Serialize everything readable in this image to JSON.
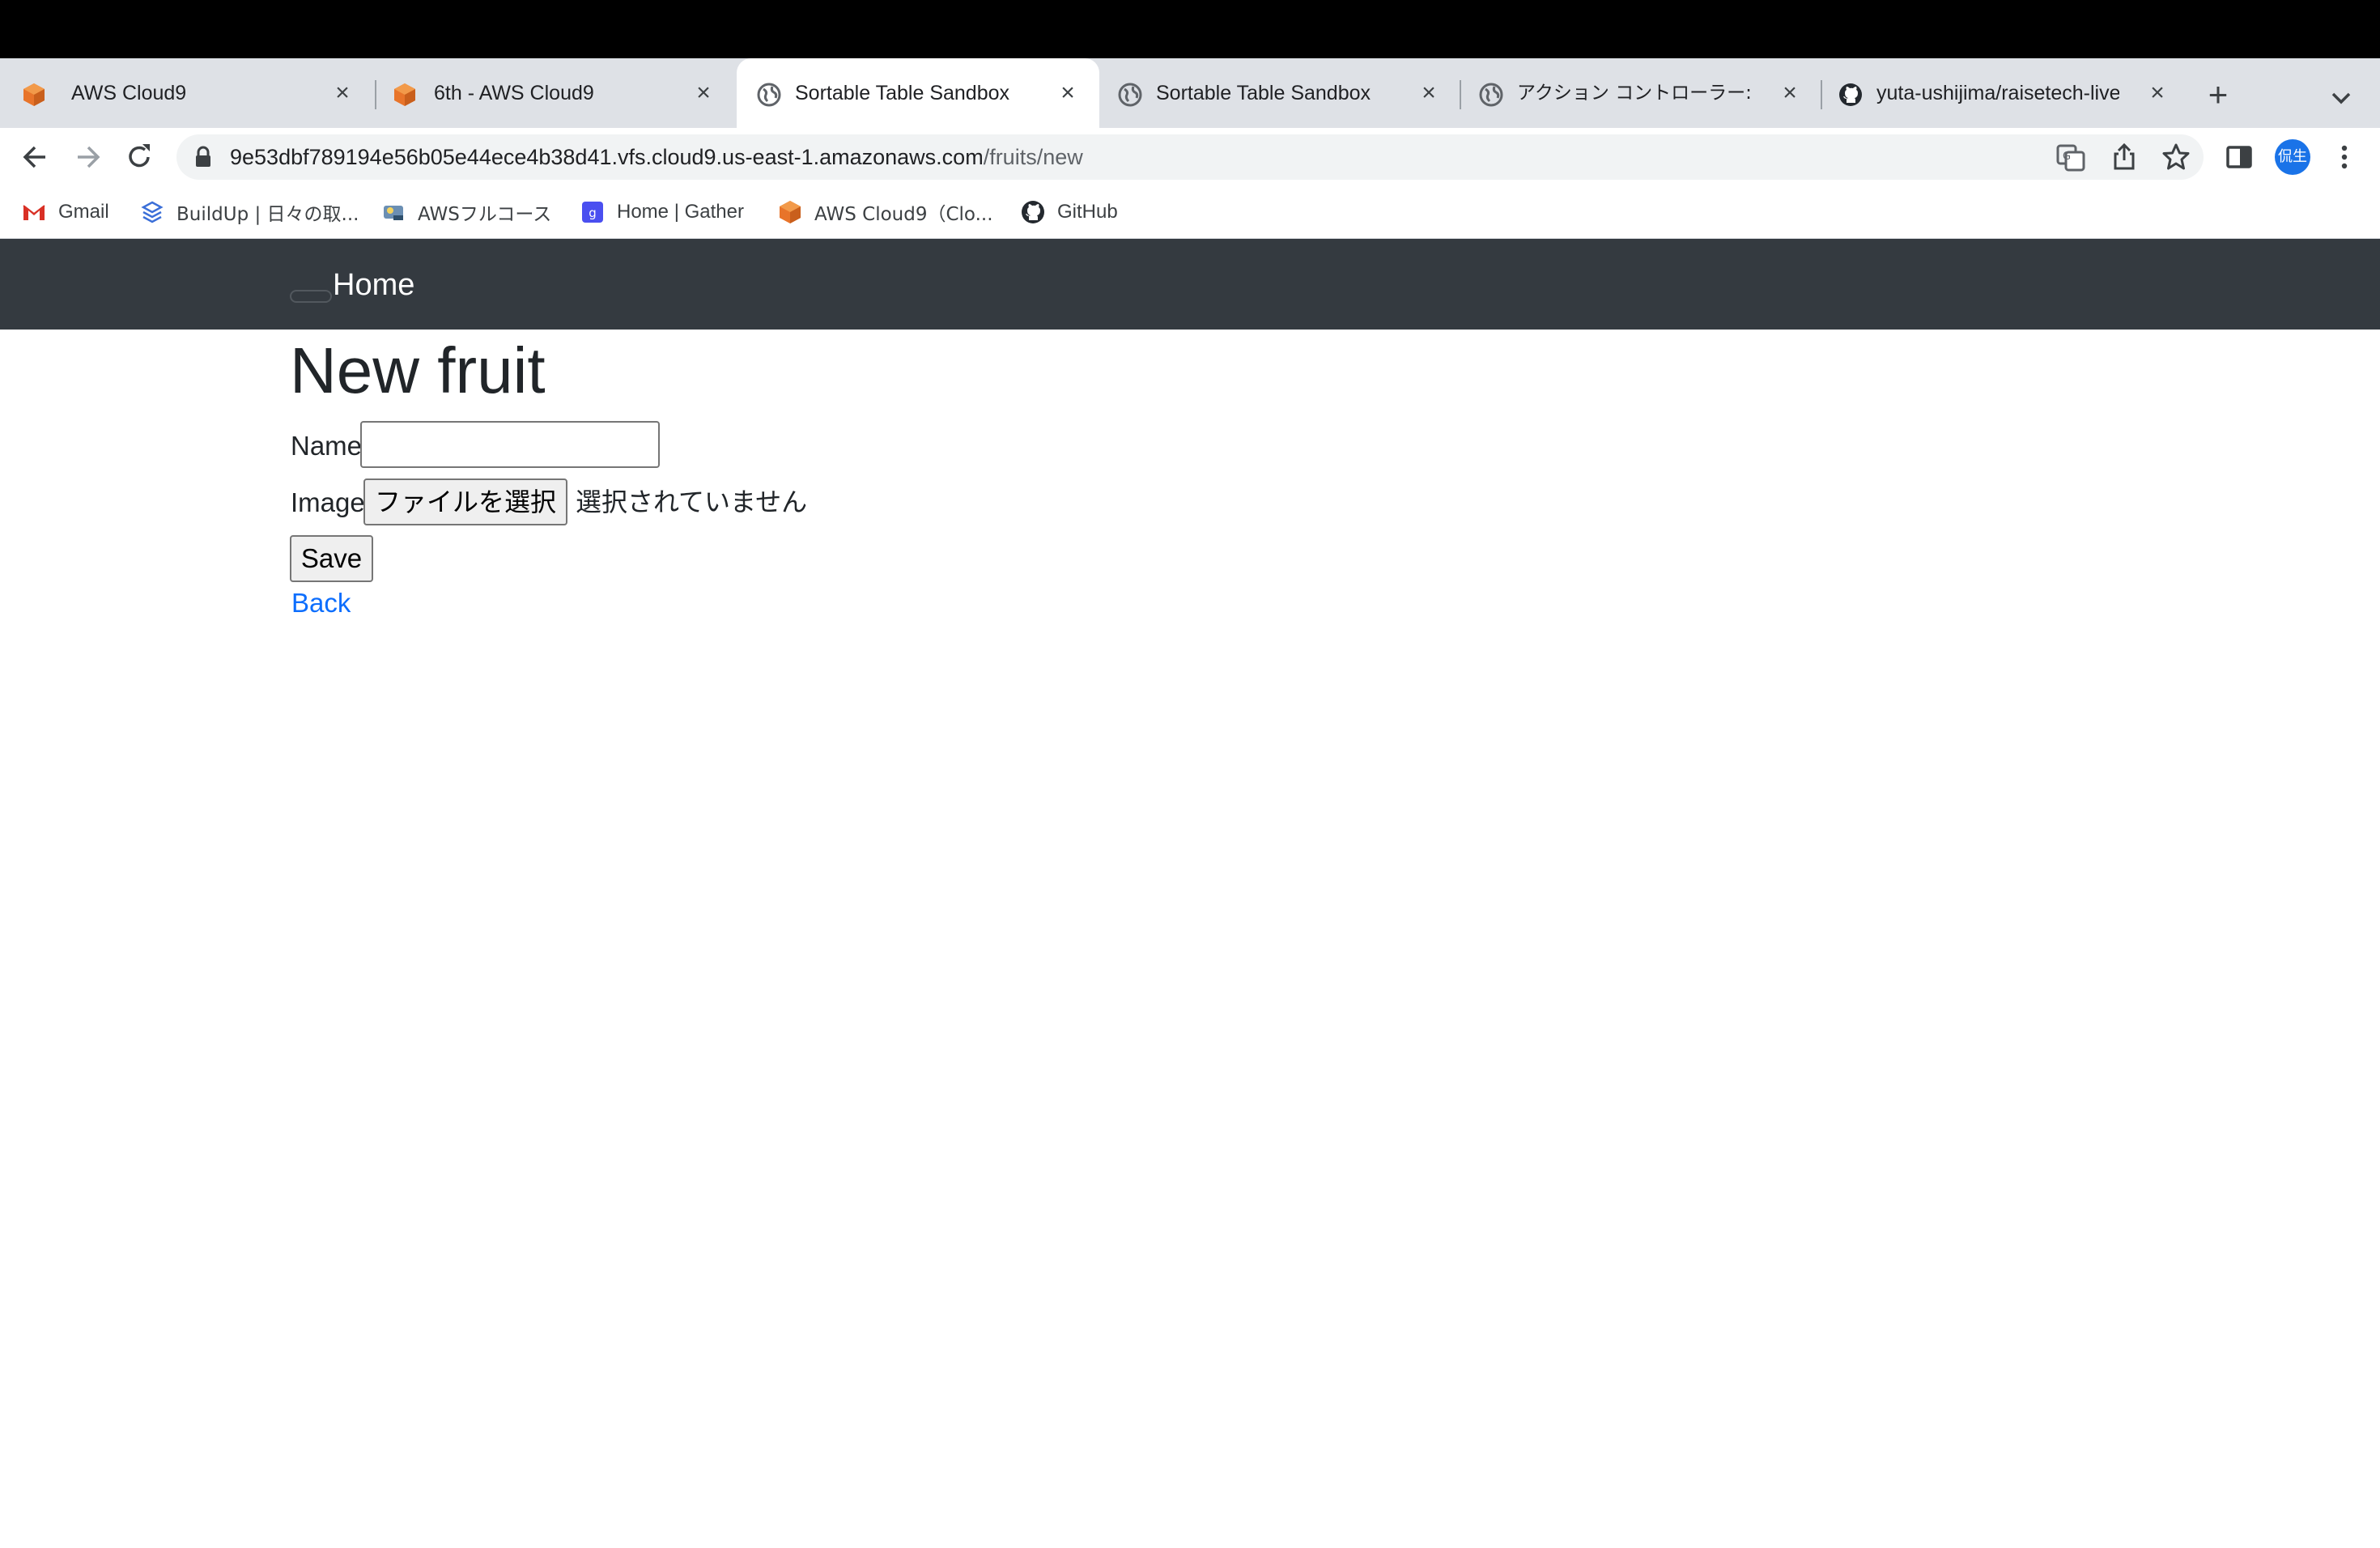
{
  "browser": {
    "tabs": [
      {
        "title": "AWS Cloud9",
        "favicon": "aws-cloud9-icon",
        "active": false
      },
      {
        "title": "6th - AWS Cloud9",
        "favicon": "aws-cloud9-icon",
        "active": false
      },
      {
        "title": "Sortable Table Sandbox",
        "favicon": "globe-icon",
        "active": true
      },
      {
        "title": "Sortable Table Sandbox",
        "favicon": "globe-icon",
        "active": false
      },
      {
        "title": "アクション コントローラー: 例外",
        "favicon": "globe-icon",
        "active": false
      },
      {
        "title": "yuta-ushijima/raisetech-live",
        "favicon": "github-icon",
        "active": false
      }
    ],
    "address": {
      "host": "9e53dbf789194e56b05e44ece4b38d41.vfs.cloud9.us-east-1.amazonaws.com",
      "path": "/fruits/new"
    },
    "profile_initials": "侃生",
    "bookmarks": [
      {
        "label": "Gmail",
        "icon": "gmail-icon"
      },
      {
        "label": "BuildUp | 日々の取...",
        "icon": "buildup-icon"
      },
      {
        "label": "AWSフルコース",
        "icon": "aws-course-icon"
      },
      {
        "label": "Home | Gather",
        "icon": "gather-icon"
      },
      {
        "label": "AWS Cloud9（Clo...",
        "icon": "aws-cloud9-icon"
      },
      {
        "label": "GitHub",
        "icon": "github-icon"
      }
    ],
    "colors": {
      "accent_profile": "#1a73e8",
      "aws_orange": "#e8742a"
    }
  },
  "navbar": {
    "brand": "Home",
    "background": "#343a40"
  },
  "page": {
    "heading": "New fruit",
    "form": {
      "name_label": "Name",
      "name_value": "",
      "image_label": "Image",
      "file_button_label": "ファイルを選択",
      "file_status": "選択されていません",
      "save_label": "Save"
    },
    "back_label": "Back",
    "link_color": "#0d6efd"
  }
}
